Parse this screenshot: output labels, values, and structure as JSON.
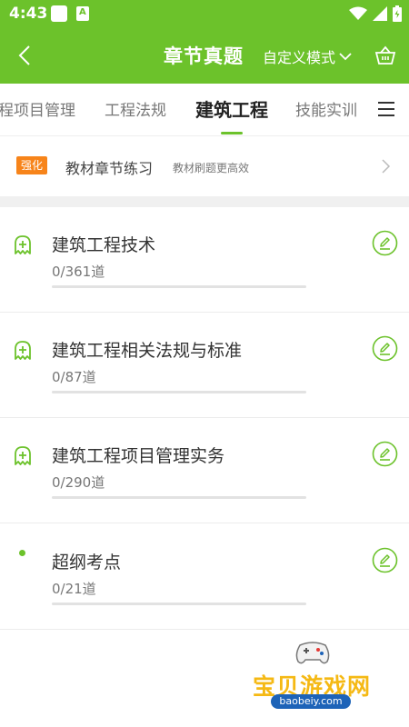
{
  "status": {
    "time": "4:43"
  },
  "header": {
    "title": "章节真题",
    "mode_label": "自定义模式"
  },
  "tabs": [
    {
      "label": "程项目管理"
    },
    {
      "label": "工程法规"
    },
    {
      "label": "建筑工程",
      "active": true
    },
    {
      "label": "技能实训"
    }
  ],
  "promo": {
    "badge": "强化",
    "title": "教材章节练习",
    "subtitle": "教材刷题更高效"
  },
  "chapters": [
    {
      "title": "建筑工程技术",
      "count": "0/361道",
      "progress": 0,
      "icon": "ghost-plus-icon"
    },
    {
      "title": "建筑工程相关法规与标准",
      "count": "0/87道",
      "progress": 0,
      "icon": "ghost-plus-icon"
    },
    {
      "title": "建筑工程项目管理实务",
      "count": "0/290道",
      "progress": 0,
      "icon": "ghost-plus-icon"
    },
    {
      "title": "超纲考点",
      "count": "0/21道",
      "progress": 0,
      "icon": "dot-icon"
    }
  ],
  "watermark": {
    "text": "宝贝游戏网",
    "url": "baobeiy.com"
  },
  "colors": {
    "brand": "#6cc22b",
    "badge": "#f7841a",
    "divider": "#f0f0f0"
  }
}
